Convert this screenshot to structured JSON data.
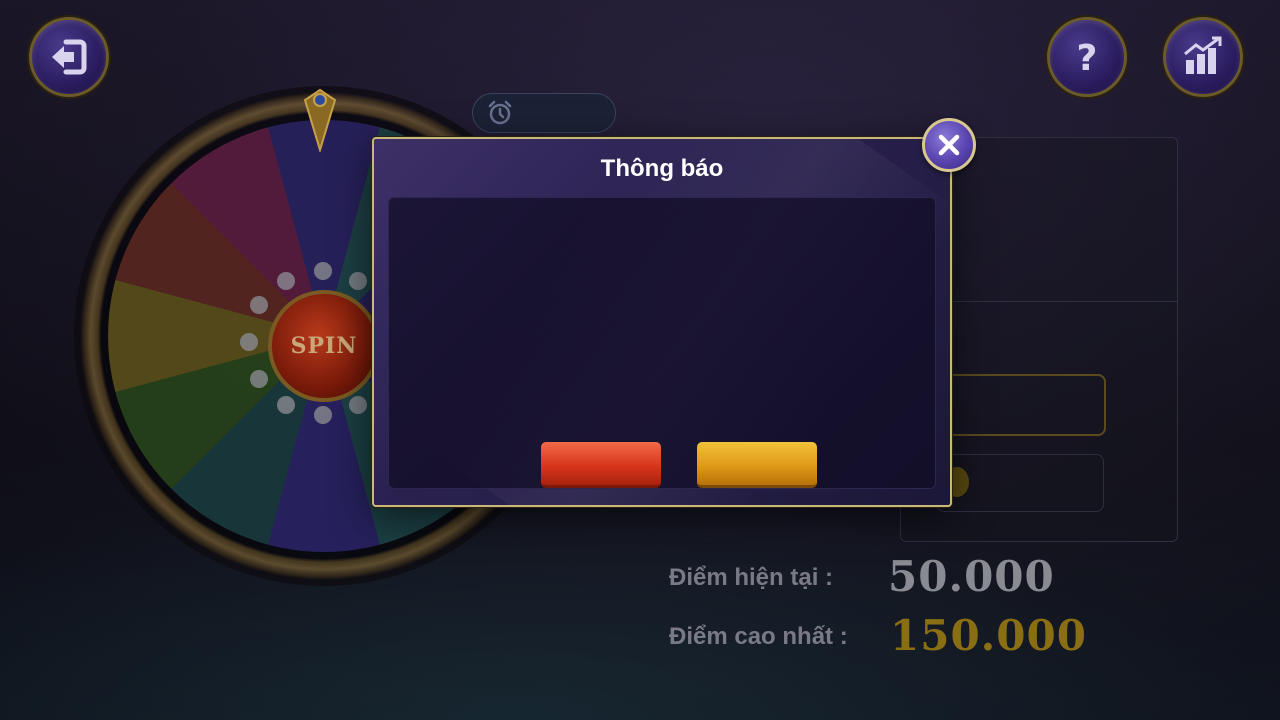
{
  "dialog": {
    "title": "Thông báo",
    "buttons": [
      {
        "label": "",
        "color": "#d9361c"
      },
      {
        "label": "",
        "color": "#e09a18"
      }
    ]
  },
  "wheel": {
    "spin_label": "SPIN"
  },
  "scores": {
    "current_label": "Điểm hiện tại :",
    "current_value": "50.000",
    "current_color": "#8a8a92",
    "best_label": "Điểm cao nhất :",
    "best_value": "150.000",
    "best_color": "#8a6e14"
  },
  "icons": {
    "back": "back-arrow-icon",
    "help": "question-icon",
    "stats": "bar-chart-icon",
    "timer": "alarm-clock-icon",
    "close": "close-icon"
  }
}
